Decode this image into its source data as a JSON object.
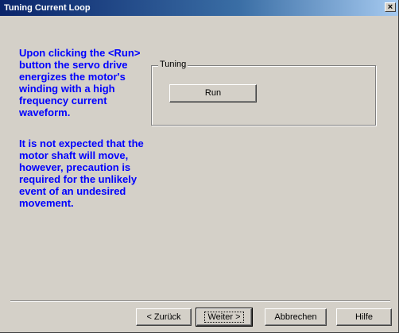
{
  "window": {
    "title": "Tuning Current Loop",
    "close_label": "×"
  },
  "description": {
    "paragraph1": "Upon clicking the <Run> button the servo drive energizes the motor's winding with a high frequency current waveform.",
    "paragraph2": "It is not expected that the motor shaft will move, however, precaution is required for the unlikely event of an undesired movement."
  },
  "tuning_group": {
    "legend": "Tuning",
    "run_label": "Run"
  },
  "footer": {
    "back_label": "< Zurück",
    "next_label": "Weiter >",
    "cancel_label": "Abbrechen",
    "help_label": "Hilfe"
  },
  "colors": {
    "description_text": "#0000ff",
    "dialog_background": "#d4d0c8",
    "titlebar_start": "#0a246a",
    "titlebar_end": "#a6caf0"
  }
}
